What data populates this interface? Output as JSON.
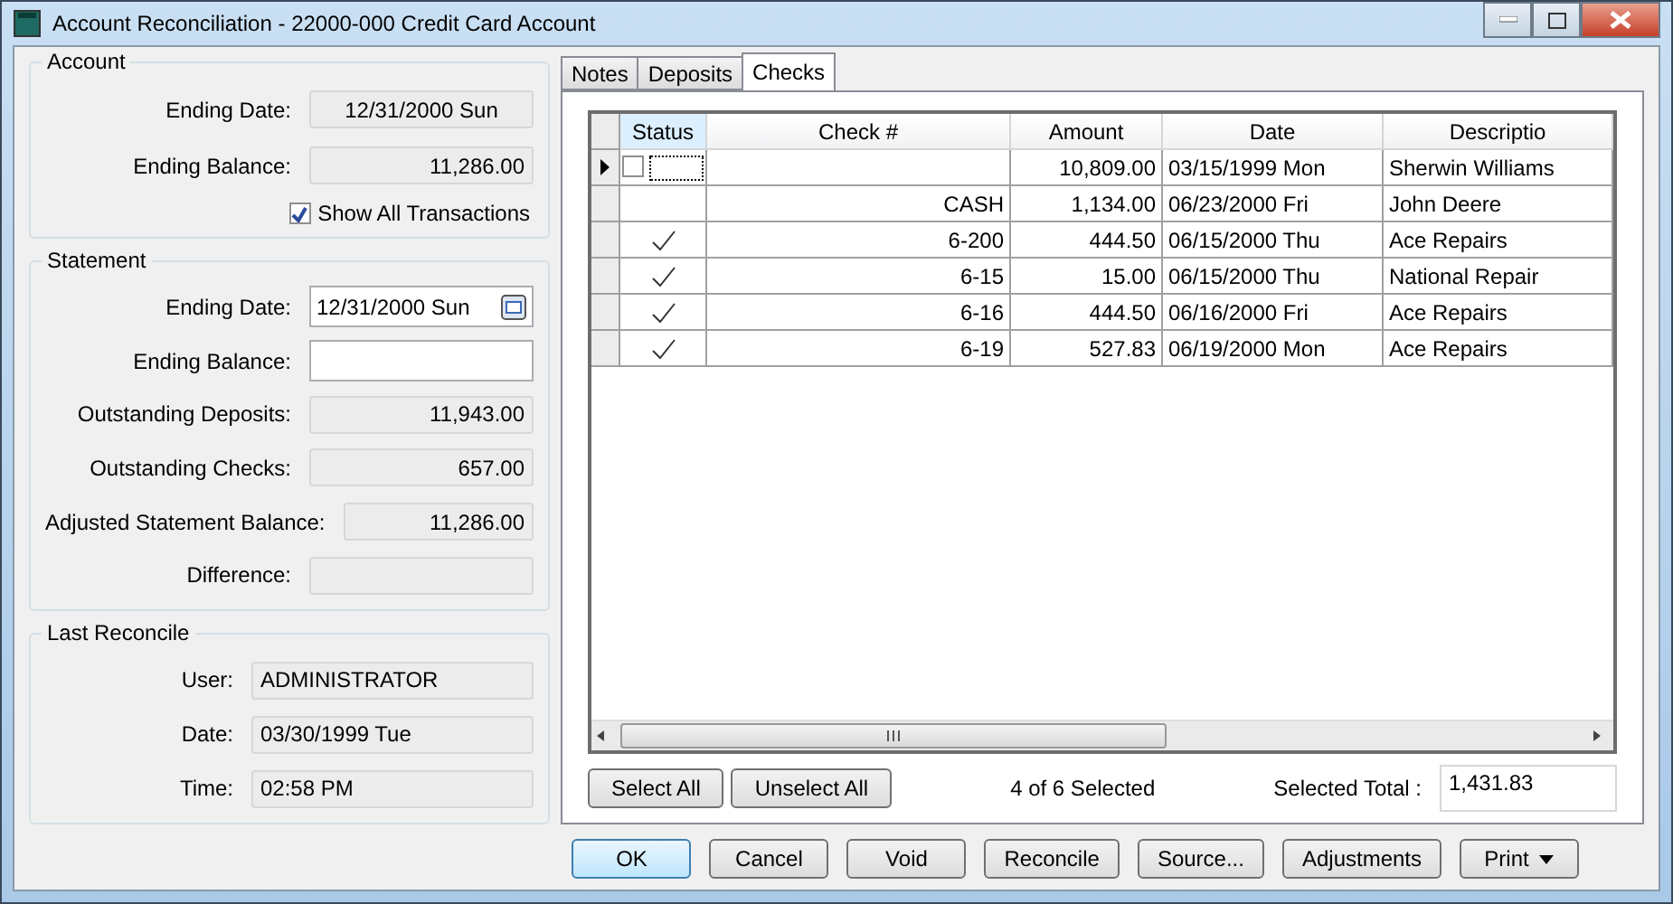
{
  "window": {
    "title": "Account Reconciliation - 22000-000 Credit Card Account"
  },
  "account": {
    "title": "Account",
    "fields": [
      {
        "label": "Ending Date:",
        "value": "12/31/2000 Sun"
      },
      {
        "label": "Ending Balance:",
        "value": "11,286.00"
      }
    ],
    "show_all": {
      "label": "Show All Transactions",
      "checked": true
    }
  },
  "statement": {
    "title": "Statement",
    "fields": [
      {
        "label": "Ending Date:",
        "value": "12/31/2000 Sun",
        "kind": "date"
      },
      {
        "label": "Ending Balance:",
        "kind": "input"
      },
      {
        "label": "Outstanding Deposits:",
        "value": "11,943.00",
        "kind": "readonly"
      },
      {
        "label": "Outstanding Checks:",
        "value": "657.00",
        "kind": "readonly"
      },
      {
        "label": "Adjusted Statement Balance:",
        "value": "11,286.00",
        "kind": "readonly"
      },
      {
        "label": "Difference:",
        "kind": "readonly"
      }
    ]
  },
  "last_reconcile": {
    "title": "Last Reconcile",
    "fields": [
      {
        "label": "User:",
        "value": "ADMINISTRATOR"
      },
      {
        "label": "Date:",
        "value": "03/30/1999 Tue"
      },
      {
        "label": "Time:",
        "value": "02:58 PM"
      }
    ]
  },
  "tabs": [
    {
      "label": "Notes",
      "selected": false
    },
    {
      "label": "Deposits",
      "selected": false
    },
    {
      "label": "Checks",
      "selected": true
    }
  ],
  "table": {
    "columns": [
      "Status",
      "Check #",
      "Amount",
      "Date",
      "Descriptio"
    ],
    "rows": [
      {
        "current": true,
        "checked": false,
        "check": "",
        "amount": "10,809.00",
        "date": "03/15/1999 Mon",
        "description": "Sherwin Williams"
      },
      {
        "current": false,
        "checked": false,
        "check": "CASH",
        "amount": "1,134.00",
        "date": "06/23/2000 Fri",
        "description": "John Deere"
      },
      {
        "current": false,
        "checked": true,
        "check": "6-200",
        "amount": "444.50",
        "date": "06/15/2000 Thu",
        "description": "Ace Repairs"
      },
      {
        "current": false,
        "checked": true,
        "check": "6-15",
        "amount": "15.00",
        "date": "06/15/2000 Thu",
        "description": "National Repair"
      },
      {
        "current": false,
        "checked": true,
        "check": "6-16",
        "amount": "444.50",
        "date": "06/16/2000 Fri",
        "description": "Ace Repairs"
      },
      {
        "current": false,
        "checked": true,
        "check": "6-19",
        "amount": "527.83",
        "date": "06/19/2000 Mon",
        "description": "Ace Repairs"
      }
    ]
  },
  "selection": {
    "buttons": [
      "Select All",
      "Unselect All"
    ],
    "summary": "4 of 6 Selected",
    "total_label": "Selected Total :",
    "total": "1,431.83"
  },
  "buttons": [
    {
      "label": "OK",
      "kind": "default"
    },
    {
      "label": "Cancel",
      "kind": "normal"
    },
    {
      "label": "Void",
      "kind": "normal"
    },
    {
      "label": "Reconcile",
      "kind": "normal"
    },
    {
      "label": "Source...",
      "kind": "normal"
    },
    {
      "label": "Adjustments",
      "kind": "normal"
    },
    {
      "label": "Print",
      "kind": "menu"
    }
  ]
}
